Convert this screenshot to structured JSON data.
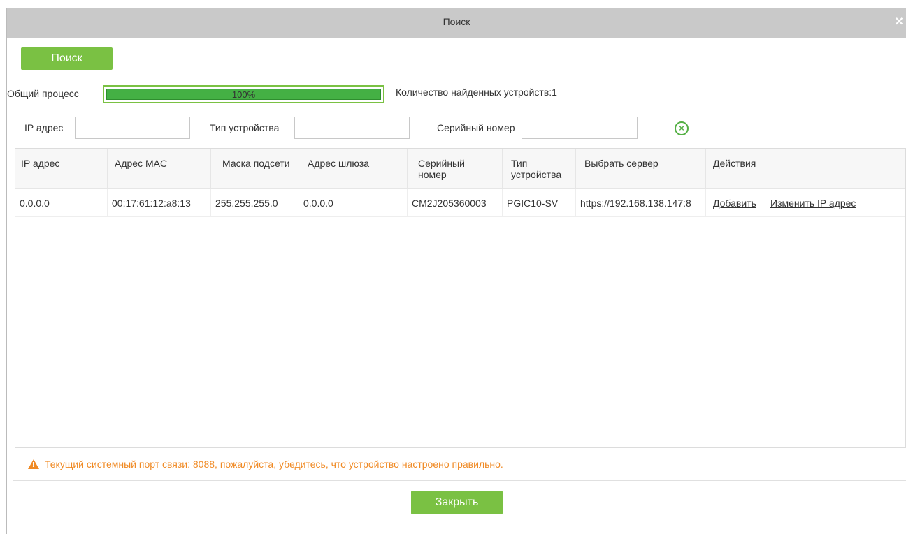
{
  "dialog": {
    "title": "Поиск",
    "close_glyph": "×"
  },
  "toolbar": {
    "search_label": "Поиск"
  },
  "progress": {
    "label": "Общий процесс",
    "percent_text": "100%",
    "value": 1.0,
    "found_text": "Количество найденных устройств:1"
  },
  "filters": {
    "ip_label": "IP адрес",
    "type_label": "Тип устройства",
    "serial_label": "Серийный номер",
    "ip_value": "",
    "type_value": "",
    "serial_value": ""
  },
  "table": {
    "columns": [
      "IP адрес",
      "Адрес MAC",
      "Маска подсети",
      "Адрес шлюза",
      "Серийный номер",
      "Тип устройства",
      "Выбрать сервер",
      "Действия"
    ],
    "rows": [
      {
        "ip": "0.0.0.0",
        "mac": "00:17:61:12:a8:13",
        "mask": "255.255.255.0",
        "gateway": "0.0.0.0",
        "serial": "CM2J205360003",
        "type": "PGIC10-SV",
        "server": "https://192.168.138.147:8",
        "action_add": "Добавить",
        "action_change_ip": "Изменить IP адрес"
      }
    ]
  },
  "warning": {
    "text": "Текущий системный порт связи: 8088, пожалуйста, убедитесь, что устройство настроено правильно.",
    "color": "#f08a24"
  },
  "footer": {
    "close_label": "Закрыть"
  },
  "colors": {
    "accent_green": "#7ac143",
    "title_bar": "#c9c9c9"
  }
}
